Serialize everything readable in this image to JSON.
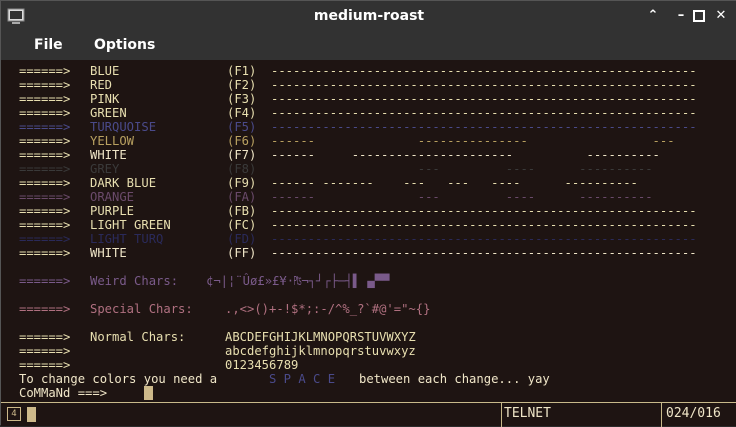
{
  "window": {
    "title": "medium-roast"
  },
  "menu": {
    "file": "File",
    "options": "Options"
  },
  "colors": {
    "bg": "#1e1412",
    "arrow": "#e8dfb0",
    "text": "#f0e6c8",
    "blue": "#e8dfb0",
    "turquoise": "#4a4a8a",
    "yellow": "#b8a060",
    "grey": "#3a3a3a",
    "orange": "#6a4a6a",
    "lightturq": "#2a2a5a",
    "weird": "#7a5a8a",
    "special": "#b07080",
    "dash_dim": "#4a4a8a"
  },
  "rows": [
    {
      "arrow": "======>",
      "name": "BLUE",
      "code": "(F1)",
      "dashes": "----------------------------------------------------------",
      "color": "#e8dfb0"
    },
    {
      "arrow": "======>",
      "name": "RED",
      "code": "(F2)",
      "dashes": "----------------------------------------------------------",
      "color": "#e8dfb0"
    },
    {
      "arrow": "======>",
      "name": "PINK",
      "code": "(F3)",
      "dashes": "----------------------------------------------------------",
      "color": "#e8dfb0"
    },
    {
      "arrow": "======>",
      "name": "GREEN",
      "code": "(F4)",
      "dashes": "----------------------------------------------------------",
      "color": "#e8dfb0"
    },
    {
      "arrow": "======>",
      "name": "TURQUOISE",
      "code": "(F5)",
      "dashes": "----------------------------------------------------------",
      "color": "#4a4a8a"
    },
    {
      "arrow": "======>",
      "name": "YELLOW",
      "code": "(F6)",
      "dashes": "------              ---------------                 ---",
      "color": "#b8a060"
    },
    {
      "arrow": "======>",
      "name": "WHITE",
      "code": "(F7)",
      "dashes": "------     ----------------------          ----------",
      "color": "#f0e6c8"
    },
    {
      "arrow": "======>",
      "name": "GREY",
      "code": "(F8)",
      "dashes": "                    ---         ----      ----------",
      "color": "#3a3a3a"
    },
    {
      "arrow": "======>",
      "name": "DARK BLUE",
      "code": "(F9)",
      "dashes": "------ -------    ---   ---   ----      ----------",
      "color": "#e8dfb0"
    },
    {
      "arrow": "======>",
      "name": "ORANGE",
      "code": "(FA)",
      "dashes": "------              ---         ----      ----------",
      "color": "#6a4a6a"
    },
    {
      "arrow": "======>",
      "name": "PURPLE",
      "code": "(FB)",
      "dashes": "----------------------------------------------------------",
      "color": "#e8dfb0"
    },
    {
      "arrow": "======>",
      "name": "LIGHT GREEN",
      "code": "(FC)",
      "dashes": "----------------------------------------------------------",
      "color": "#e8dfb0"
    },
    {
      "arrow": "======>",
      "name": "LIGHT TURQ",
      "code": "(FD)",
      "dashes": "----------------------------------------------------------",
      "color": "#2a2a5a"
    },
    {
      "arrow": "======>",
      "name": "WHITE",
      "code": "(FF)",
      "dashes": "----------------------------------------------------------",
      "color": "#f0e6c8"
    }
  ],
  "weird": {
    "arrow": "======>",
    "label": "Weird Chars:",
    "chars": "¢¬|¦¨Ûø£»£¥·₧¬┐┘┌├─┤▌ ▄▀▀"
  },
  "special": {
    "arrow": "======>",
    "label": "Special Chars:",
    "chars": ".,<>()+-!$*;:-/^%_?`#@'=\"~{}"
  },
  "normal": {
    "arrow": "======>",
    "label": "Normal Chars:",
    "line1": "ABCDEFGHIJKLMNOPQRSTUVWXYZ",
    "line2": "abcdefghijklmnopqrstuvwxyz",
    "line3": "0123456789"
  },
  "footer_text": {
    "part1": "To change colors you need a",
    "space": "S P A C E",
    "part2": "between each change... yay"
  },
  "prompt": "CoMMaNd ===>",
  "status": {
    "mode": "TELNET",
    "position": "024/016"
  }
}
